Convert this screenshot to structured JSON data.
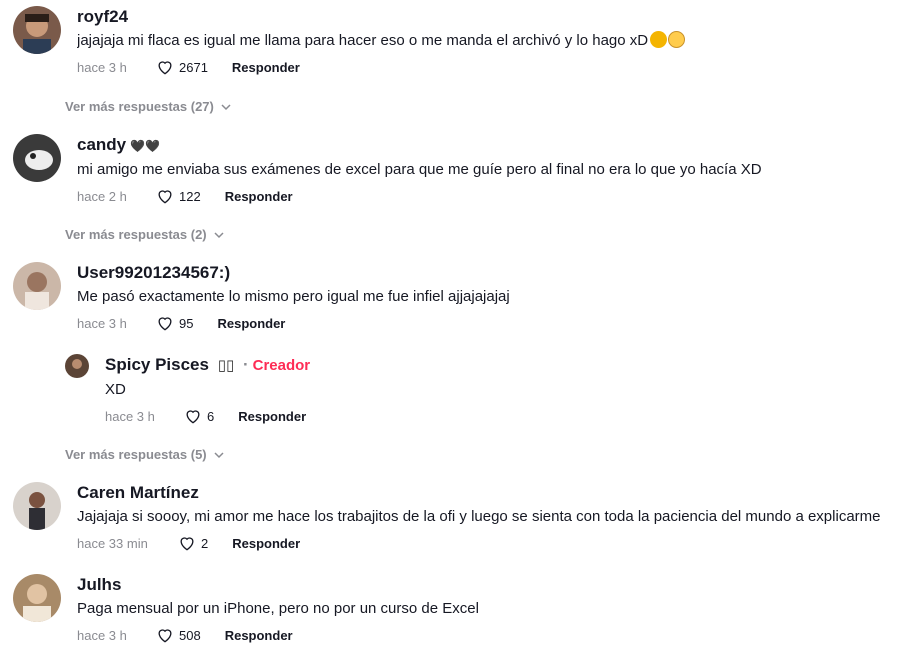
{
  "colors": {
    "creator": "#fe2c55",
    "muted": "#8a8b91",
    "text": "#161823"
  },
  "comments": [
    {
      "username": "royf24",
      "text": "jajajaja mi flaca es igual me llama para hacer eso o me manda el archivó y lo hago xD",
      "time": "hace 3 h",
      "likes": "2671",
      "reply_label": "Responder",
      "more_label": "Ver más respuestas (27)"
    },
    {
      "username": "candy",
      "username_tag": "🖤🖤",
      "text": "mi amigo me enviaba sus exámenes de excel para que me guíe pero al final no era lo que yo hacía XD",
      "time": "hace 2 h",
      "likes": "122",
      "reply_label": "Responder",
      "more_label": "Ver más respuestas (2)"
    },
    {
      "username": "User99201234567:)",
      "text": "Me pasó exactamente lo mismo pero igual me fue infiel ajjajajajaj",
      "time": "hace 3 h",
      "likes": "95",
      "reply_label": "Responder",
      "reply": {
        "username": "Spicy Pisces",
        "username_tag": "▯▯",
        "creator_label": "Creador",
        "text": "XD",
        "time": "hace 3 h",
        "likes": "6",
        "reply_label": "Responder"
      },
      "more_label": "Ver más respuestas (5)"
    },
    {
      "username": "Caren Martínez",
      "text": "Jajajaja si soooy, mi amor me hace los trabajitos de la ofi y luego se sienta con toda la paciencia del mundo a explicarme",
      "time": "hace 33 min",
      "likes": "2",
      "reply_label": "Responder"
    },
    {
      "username": "Julhs",
      "text": "Paga mensual por un iPhone, pero no por un curso de Excel",
      "time": "hace 3 h",
      "likes": "508",
      "reply_label": "Responder"
    }
  ]
}
